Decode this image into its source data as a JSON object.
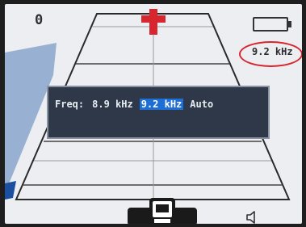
{
  "status": {
    "counter": "0",
    "battery_icon": "battery-icon",
    "frequency_display": "9.2 kHz"
  },
  "freq_dialog": {
    "label": "Freq:",
    "options": [
      {
        "label": "8.9 kHz",
        "selected": false
      },
      {
        "label": "9.2 kHz",
        "selected": true
      },
      {
        "label": "Auto",
        "selected": false
      }
    ]
  },
  "icons": {
    "center_marker": "crosshair-icon",
    "speaker": "speaker-icon",
    "device": "detector-device-icon"
  },
  "colors": {
    "screen_bg": "#eceef2",
    "accent_red": "#d8262e",
    "signal_blue": "#8aa6cc",
    "dialog_bg": "#2f3848",
    "selection_blue": "#1d6fd6"
  }
}
